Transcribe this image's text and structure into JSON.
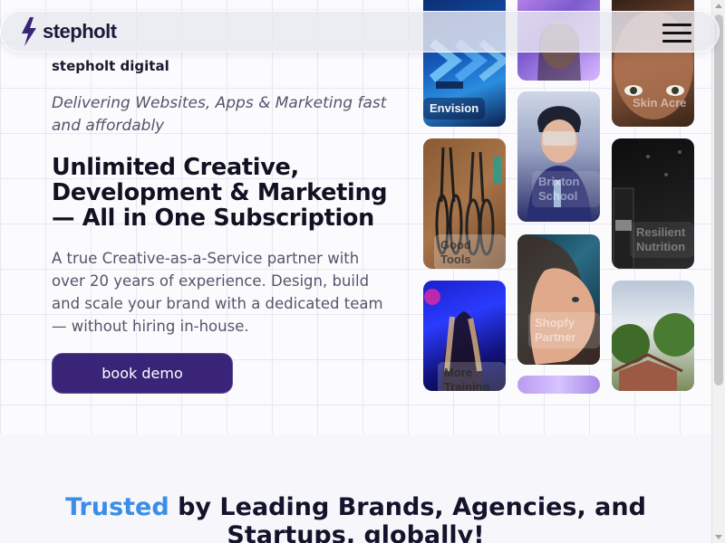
{
  "nav": {
    "logo_text": "stepholt",
    "menu_icon": "hamburger-menu-icon"
  },
  "hero": {
    "company_name": "stepholt digital",
    "tagline": "Delivering Websites, Apps & Marketing fast and affordably",
    "headline": "Unlimited Creative, Development & Marketing — All in One Subscription",
    "description": "A true Creative-as-a-Service partner with over 20 years of experience. Design, build and scale your brand with a dedicated team — without hiring in-house.",
    "cta_label": "book demo"
  },
  "gallery": {
    "tiles": [
      {
        "label": "Envision"
      },
      {
        "label": ""
      },
      {
        "label": "Skin Acre"
      },
      {
        "label": "Good Tools"
      },
      {
        "label": "Brixton School"
      },
      {
        "label": "Resilient Nutrition"
      },
      {
        "label": "Shopfy Partner"
      },
      {
        "label": "More Training"
      },
      {
        "label": ""
      }
    ]
  },
  "trusted": {
    "accent": "Trusted",
    "rest": "by Leading Brands, Agencies, and Startups, globally!"
  },
  "colors": {
    "brand": "#3a2477",
    "accent": "#3a8ee8"
  }
}
